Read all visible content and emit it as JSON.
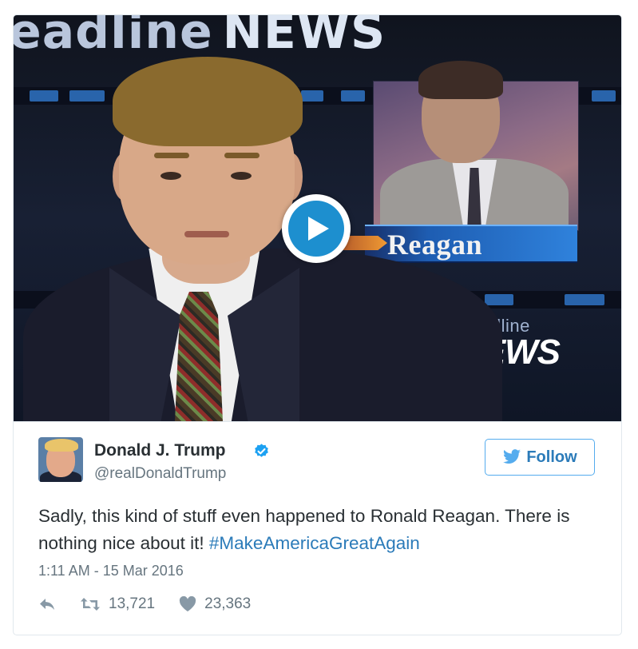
{
  "media": {
    "banner_text_left": "eadline",
    "banner_text_right": "NEWS",
    "lower_third_name": "Reagan",
    "bug_top": "Headline",
    "bug_bottom": "NEWS",
    "play_icon": "play-icon",
    "colors": {
      "play_blue": "#1d8fcf"
    }
  },
  "tweet": {
    "author_name": "Donald J. Trump",
    "author_handle": "@realDonaldTrump",
    "verified_icon": "verified-badge-icon",
    "follow_label": "Follow",
    "text_plain": "Sadly, this kind of stuff even happened to Ronald Reagan. There is nothing nice about it! ",
    "hashtag": "#MakeAmericaGreatAgain",
    "timestamp": "1:11 AM - 15 Mar 2016",
    "retweets": "13,721",
    "likes": "23,363",
    "colors": {
      "link": "#2b7bb9",
      "text": "#292f33",
      "muted": "#66757f",
      "border": "#e1e8ed"
    }
  }
}
